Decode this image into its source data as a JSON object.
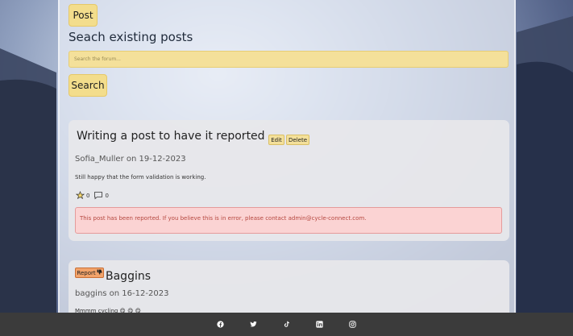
{
  "header": {
    "post_button_label": "Post",
    "search_heading": "Seach existing posts",
    "search_placeholder": "Search the forum...",
    "search_button_label": "Search"
  },
  "posts": [
    {
      "title": "Writing a post to have it reported",
      "edit_label": "Edit",
      "delete_label": "Delete",
      "meta": "Sofia_Muller on 19-12-2023",
      "body": "Still happy that the form validation is working.",
      "likes": "0",
      "comments": "0",
      "alert": "This post has been reported. If you believe this is in error, please contact admin@cycle-connect.com."
    },
    {
      "report_label": "Report",
      "title": "Baggins",
      "meta": "baggins on 16-12-2023",
      "body": "Mmmm cycling 😋 😋 😋"
    }
  ],
  "footer": {
    "icons": [
      "facebook-icon",
      "twitter-icon",
      "tiktok-icon",
      "linkedin-icon",
      "instagram-icon"
    ]
  },
  "colors": {
    "button_yellow": "#f3dd8c",
    "alert_bg": "#fbd3d3",
    "alert_text": "#b5473f",
    "report_orange": "#f2a36a",
    "footer_bg": "#3b3b3b"
  }
}
